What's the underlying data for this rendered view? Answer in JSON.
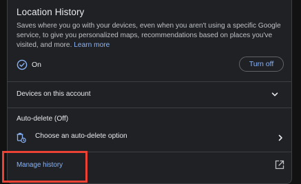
{
  "location_history": {
    "title": "Location History",
    "description": "Saves where you go with your devices, even when you aren't using a specific Google service, to give you personalized maps, recommendations based on places you've visited, and more.",
    "learn_more": "Learn more",
    "status": "On",
    "turn_off_label": "Turn off",
    "devices_label": "Devices on this account",
    "auto_delete_title": "Auto-delete (Off)",
    "auto_delete_option": "Choose an auto-delete option",
    "manage_history": "Manage history"
  },
  "icons": {
    "status": "check-circle-icon",
    "devices": "chevron-down-icon",
    "auto_delete": "auto-delete-icon",
    "auto_delete_chevron": "chevron-right-icon",
    "manage_history": "open-in-new-icon"
  },
  "colors": {
    "background": "#202124",
    "text_primary": "#e8eaed",
    "text_secondary": "#bdc1c6",
    "accent": "#8ab4f8",
    "highlight": "#ea4335"
  }
}
